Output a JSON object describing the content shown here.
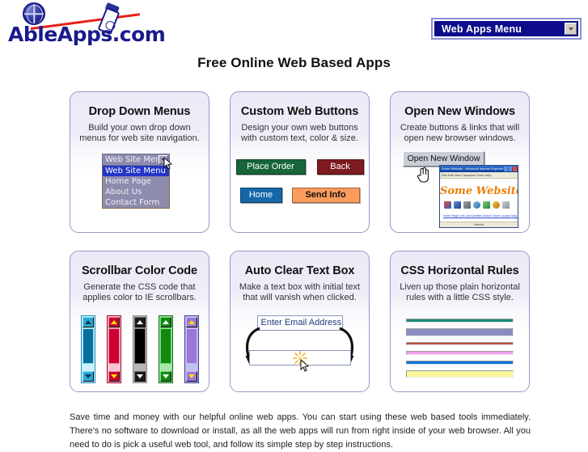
{
  "brand": {
    "name": "AbleApps.com",
    "name_part1": "A",
    "name_part2": "ble",
    "name_part3": "A",
    "name_part4": "pps.com",
    "logo_icon": "globe-icon",
    "phone_icon": "mobile-phone-icon",
    "rule_color": "#e8201a",
    "text_color": "#1a1a8c"
  },
  "header": {
    "menu_label": "Web Apps Menu",
    "menu_arrow_icon": "chevron-down-icon",
    "menu_bg": "#0d0d8c",
    "page_title": "Free Online Web Based Apps"
  },
  "cards": [
    {
      "id": "drop-down-menus",
      "title": "Drop Down Menus",
      "description": "Build your own drop down menus for web site navigation.",
      "demo": {
        "type": "select",
        "selected": "Web Site Menu",
        "options": [
          "Web Site Menu",
          "Home Page",
          "About Us",
          "Contact Form"
        ],
        "highlighted": "Web Site Menu",
        "cursor_icon": "arrow-cursor-icon"
      }
    },
    {
      "id": "custom-web-buttons",
      "title": "Custom Web Buttons",
      "description": "Design your own web buttons with custom text, color & size.",
      "demo": {
        "type": "buttons",
        "buttons": [
          {
            "label": "Place Order",
            "color": "#17653a",
            "text_color": "#ffffff"
          },
          {
            "label": "Back",
            "color": "#7d1b21",
            "text_color": "#ffffff"
          },
          {
            "label": "Home",
            "color": "#1667a8",
            "text_color": "#ffffff"
          },
          {
            "label": "Send Info",
            "color": "#fb9b5c",
            "text_color": "#111111"
          }
        ]
      }
    },
    {
      "id": "open-new-windows",
      "title": "Open New Windows",
      "description": "Create buttons & links that will open new browser windows.",
      "demo": {
        "type": "new-window",
        "button_label": "Open New Window",
        "cursor_icon": "pointing-hand-icon",
        "window": {
          "title_bar_text": "Some Website - Microsoft Internet Explorer",
          "menu_text": "File  Edit  View  Favorites  Tools  Help",
          "heading": "Some Website",
          "heading_color": "#e8820c",
          "links_text": "Home Page   Link List   Activities   Search   Store Locator   Map   Contact",
          "status_text": "Internet",
          "icon_count": 7
        }
      }
    },
    {
      "id": "scrollbar-color-code",
      "title": "Scrollbar Color Code",
      "description": "Generate the CSS code that applies color to IE scrollbars.",
      "demo": {
        "type": "scrollbars",
        "bars": [
          {
            "name": "cyan",
            "track": "#cdf2fb",
            "thumb": "#0b6f9e",
            "button": "#2aa8d4",
            "border": "#1b8cb8",
            "arrow": "#0b3b55",
            "highlight": "#8fe0f5"
          },
          {
            "name": "red",
            "track": "#f7c6d2",
            "thumb": "#cc0033",
            "button": "#cc0033",
            "border": "#a60028",
            "arrow": "#ffe100",
            "highlight": "#f0889f"
          },
          {
            "name": "black",
            "track": "#b5b5b5",
            "thumb": "#000000",
            "button": "#1a1a1a",
            "border": "#8c8c8c",
            "arrow": "#ffffff",
            "highlight": "#6b6b6b"
          },
          {
            "name": "green",
            "track": "#a6e7a6",
            "thumb": "#108a10",
            "button": "#108a10",
            "border": "#0b6b0b",
            "arrow": "#ffffff",
            "highlight": "#6fd46f"
          },
          {
            "name": "purple",
            "track": "#c4c2ee",
            "thumb": "#9b77d8",
            "button": "#9b77d8",
            "border": "#3b3b9e",
            "arrow": "#ffe100",
            "highlight": "#cdb8ef"
          }
        ]
      }
    },
    {
      "id": "auto-clear-text-box",
      "title": "Auto Clear Text Box",
      "description": "Make a text box with initial text that will vanish when clicked.",
      "demo": {
        "type": "textbox",
        "filled_value": "Enter Email Address",
        "empty_value": "",
        "cursor_icon": "arrow-cursor-icon",
        "sparkle_icon": "sparkle-icon",
        "arrow_left_icon": "curved-arrow-down-icon",
        "arrow_right_icon": "curved-arrow-down-icon"
      }
    },
    {
      "id": "css-horizontal-rules",
      "title": "CSS Horizontal Rules",
      "description": "Liven up those plain horizontal rules with a little CSS style.",
      "demo": {
        "type": "rules",
        "rules": [
          {
            "color": "#1d8a7a",
            "height": 5
          },
          {
            "color": "#8b8cc0",
            "height": 10
          },
          {
            "color": "#c0503f",
            "height": 4
          },
          {
            "color": "#f2a0ee",
            "height": 5
          },
          {
            "color": "#0f74d8",
            "height": 5
          },
          {
            "color": "#fbf79a",
            "height": 9
          }
        ]
      }
    }
  ],
  "footer": {
    "paragraph": "Save time and money with our helpful online web apps. You can start using these web based tools immediately. There's no software to download or install, as all the web apps will run from right inside of your web browser. All you need to do is pick a useful web tool, and follow its simple step by step instructions."
  }
}
